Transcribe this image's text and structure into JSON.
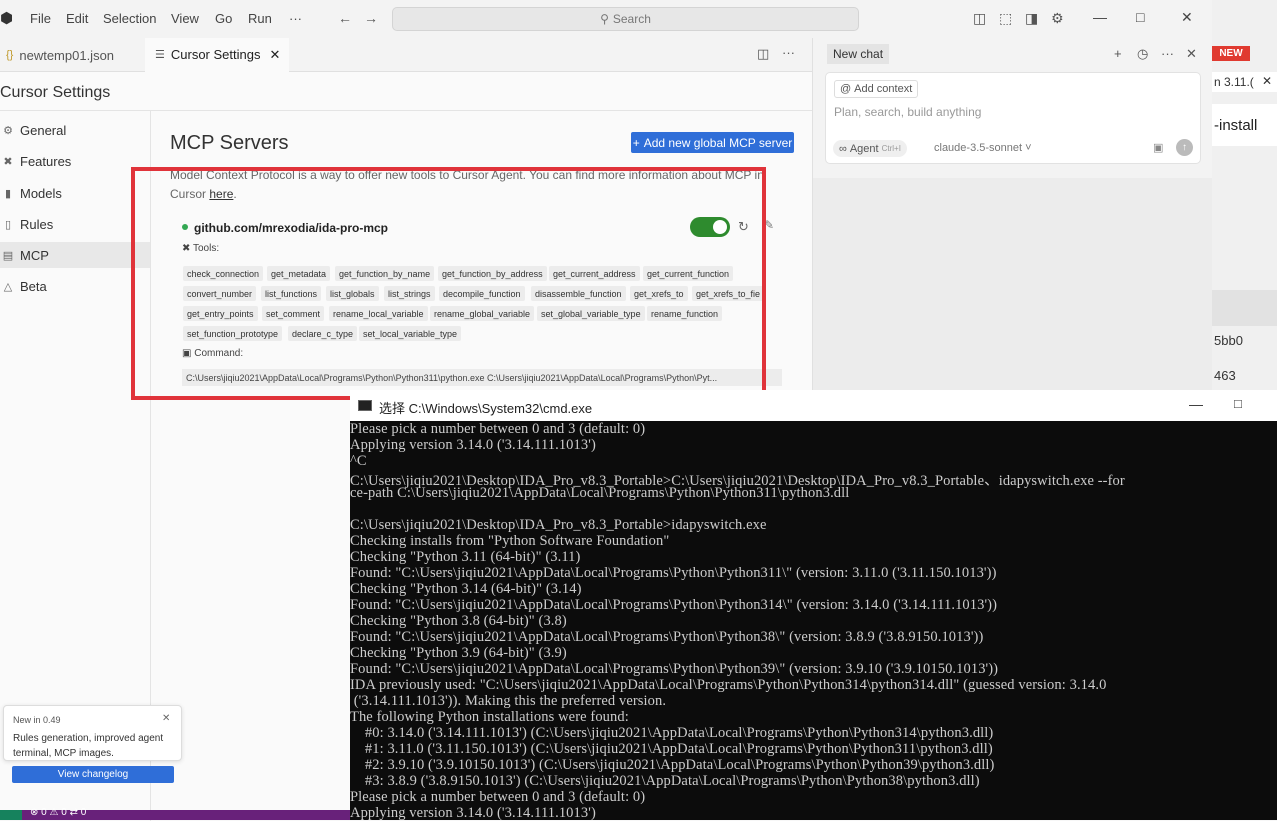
{
  "menu": {
    "items": [
      "File",
      "Edit",
      "Selection",
      "View",
      "Go",
      "Run",
      "···"
    ],
    "search_placeholder": "Search"
  },
  "tabs": [
    {
      "label": "newtemp01.json",
      "icon": "json-file-icon"
    },
    {
      "label": "Cursor Settings",
      "icon": "settings-sliders-icon"
    }
  ],
  "settings": {
    "title": "Cursor Settings",
    "nav": [
      {
        "label": "General",
        "icon": "gear-icon"
      },
      {
        "label": "Features",
        "icon": "tools-icon"
      },
      {
        "label": "Models",
        "icon": "chart-icon"
      },
      {
        "label": "Rules",
        "icon": "book-icon"
      },
      {
        "label": "MCP",
        "icon": "server-icon"
      },
      {
        "label": "Beta",
        "icon": "flask-icon"
      }
    ],
    "selected_nav": "MCP",
    "section_title": "MCP Servers",
    "add_button": "Add new global MCP server",
    "description": "Model Context Protocol is a way to offer new tools to Cursor Agent. You can find more information about MCP in Cursor",
    "description_link": "here",
    "server": {
      "name": "github.com/mrexodia/ida-pro-mcp",
      "enabled": true,
      "status_color": "#33a853",
      "tools_label": "Tools:",
      "tools": [
        "check_connection",
        "get_metadata",
        "get_function_by_name",
        "get_function_by_address",
        "get_current_address",
        "get_current_function",
        "convert_number",
        "list_functions",
        "list_globals",
        "list_strings",
        "decompile_function",
        "disassemble_function",
        "get_xrefs_to",
        "get_xrefs_to_fie",
        "get_entry_points",
        "set_comment",
        "rename_local_variable",
        "rename_global_variable",
        "set_global_variable_type",
        "rename_function",
        "set_function_prototype",
        "declare_c_type",
        "set_local_variable_type"
      ],
      "command_label": "Command:",
      "command": "C:\\Users\\jiqiu2021\\AppData\\Local\\Programs\\Python\\Python311\\python.exe C:\\Users\\jiqiu2021\\AppData\\Local\\Programs\\Python\\Pyt..."
    }
  },
  "toast": {
    "title": "New in 0.49",
    "body": "Rules generation, improved agent terminal, MCP images.",
    "button": "View changelog"
  },
  "status_bar": {
    "text": "⊗ 0 ⚠ 0   ⇄ 0"
  },
  "chat": {
    "tab": "New chat",
    "add_context": "Add context",
    "placeholder": "Plan, search, build anything",
    "mode": "Agent",
    "mode_shortcut": "Ctrl+I",
    "model": "claude-3.5-sonnet"
  },
  "background_window": {
    "badge": "NEW",
    "tab_fragment": "n 3.11.(",
    "install_fragment": "-install",
    "hash1": "5bb0",
    "hash2": "463"
  },
  "cmd": {
    "title": "选择 C:\\Windows\\System32\\cmd.exe",
    "lines": [
      "Please pick a number between 0 and 3 (default: 0)",
      "Applying version 3.14.0 ('3.14.111.1013')",
      "^C",
      "C:\\Users\\jiqiu2021\\Desktop\\IDA_Pro_v8.3_Portable>C:\\Users\\jiqiu2021\\Desktop\\IDA_Pro_v8.3_Portable、idapyswitch.exe --for",
      "ce-path C:\\Users\\jiqiu2021\\AppData\\Local\\Programs\\Python\\Python311\\python3.dll",
      "",
      "C:\\Users\\jiqiu2021\\Desktop\\IDA_Pro_v8.3_Portable>idapyswitch.exe",
      "Checking installs from \"Python Software Foundation\"",
      "Checking \"Python 3.11 (64-bit)\" (3.11)",
      "Found: \"C:\\Users\\jiqiu2021\\AppData\\Local\\Programs\\Python\\Python311\\\" (version: 3.11.0 ('3.11.150.1013'))",
      "Checking \"Python 3.14 (64-bit)\" (3.14)",
      "Found: \"C:\\Users\\jiqiu2021\\AppData\\Local\\Programs\\Python\\Python314\\\" (version: 3.14.0 ('3.14.111.1013'))",
      "Checking \"Python 3.8 (64-bit)\" (3.8)",
      "Found: \"C:\\Users\\jiqiu2021\\AppData\\Local\\Programs\\Python\\Python38\\\" (version: 3.8.9 ('3.8.9150.1013'))",
      "Checking \"Python 3.9 (64-bit)\" (3.9)",
      "Found: \"C:\\Users\\jiqiu2021\\AppData\\Local\\Programs\\Python\\Python39\\\" (version: 3.9.10 ('3.9.10150.1013'))",
      "IDA previously used: \"C:\\Users\\jiqiu2021\\AppData\\Local\\Programs\\Python\\Python314\\python314.dll\" (guessed version: 3.14.0",
      " ('3.14.111.1013')). Making this the preferred version.",
      "The following Python installations were found:",
      "    #0: 3.14.0 ('3.14.111.1013') (C:\\Users\\jiqiu2021\\AppData\\Local\\Programs\\Python\\Python314\\python3.dll)",
      "    #1: 3.11.0 ('3.11.150.1013') (C:\\Users\\jiqiu2021\\AppData\\Local\\Programs\\Python\\Python311\\python3.dll)",
      "    #2: 3.9.10 ('3.9.10150.1013') (C:\\Users\\jiqiu2021\\AppData\\Local\\Programs\\Python\\Python39\\python3.dll)",
      "    #3: 3.8.9 ('3.8.9150.1013') (C:\\Users\\jiqiu2021\\AppData\\Local\\Programs\\Python\\Python38\\python3.dll)",
      "Please pick a number between 0 and 3 (default: 0)",
      "Applying version 3.14.0 ('3.14.111.1013')"
    ]
  },
  "colors": {
    "accent": "#2f6ed8",
    "highlight_border": "#e0333a",
    "toggle_on": "#2e8b2e",
    "statusbar": "#68217a",
    "console_bg": "#0c0c0c",
    "console_text": "#cccccc"
  }
}
